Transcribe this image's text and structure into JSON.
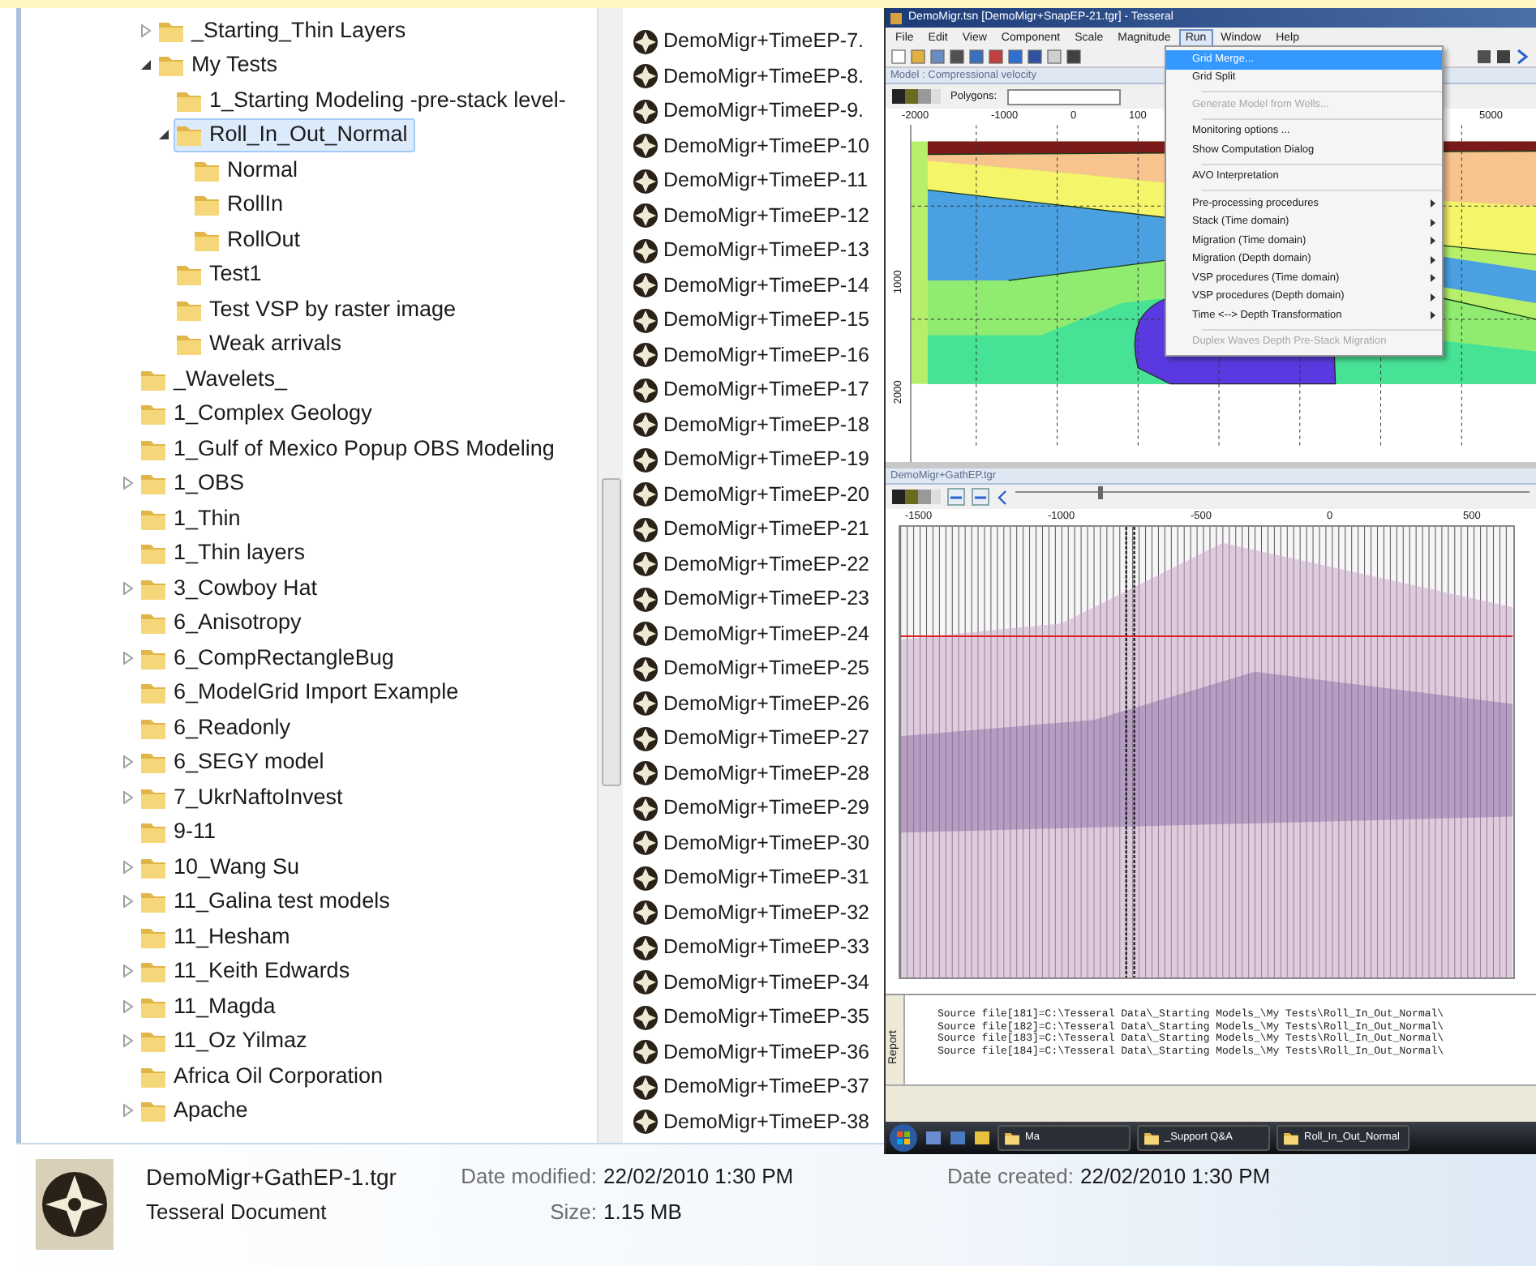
{
  "tree": {
    "nested_items": [
      {
        "label": "_Starting_Thin Layers",
        "expanded": false,
        "selected": false
      },
      {
        "label": "My Tests",
        "expanded": true,
        "selected": false,
        "children": [
          {
            "label": "1_Starting Modeling -pre-stack level-",
            "selected": false
          },
          {
            "label": "Roll_In_Out_Normal",
            "expanded": true,
            "selected": true,
            "children": [
              {
                "label": "Normal",
                "selected": false
              },
              {
                "label": "RollIn",
                "selected": false
              },
              {
                "label": "RollOut",
                "selected": false
              }
            ]
          },
          {
            "label": "Test1",
            "selected": false
          },
          {
            "label": "Test VSP by raster image",
            "selected": false
          },
          {
            "label": "Weak arrivals",
            "selected": false
          }
        ]
      }
    ],
    "items": [
      {
        "label": "_Wavelets_",
        "selected": false
      },
      {
        "label": "1_Complex Geology",
        "selected": false
      },
      {
        "label": "1_Gulf of Mexico Popup OBS Modeling",
        "selected": false
      },
      {
        "label": "1_OBS",
        "expanded": false,
        "selected": false
      },
      {
        "label": "1_Thin",
        "selected": false
      },
      {
        "label": "1_Thin layers",
        "selected": false
      },
      {
        "label": "3_Cowboy Hat",
        "expanded": false,
        "selected": false
      },
      {
        "label": "6_Anisotropy",
        "selected": false
      },
      {
        "label": "6_CompRectangleBug",
        "expanded": false,
        "selected": false
      },
      {
        "label": "6_ModelGrid Import Example",
        "selected": false
      },
      {
        "label": "6_Readonly",
        "selected": false
      },
      {
        "label": "6_SEGY model",
        "expanded": false,
        "selected": false
      },
      {
        "label": "7_UkrNaftoInvest",
        "expanded": false,
        "selected": false
      },
      {
        "label": "9-11",
        "selected": false
      },
      {
        "label": "10_Wang Su",
        "expanded": false,
        "selected": false
      },
      {
        "label": "11_Galina test models",
        "expanded": false,
        "selected": false
      },
      {
        "label": "11_Hesham",
        "selected": false
      },
      {
        "label": "11_Keith Edwards",
        "expanded": false,
        "selected": false
      },
      {
        "label": "11_Magda",
        "expanded": false,
        "selected": false
      },
      {
        "label": "11_Oz Yilmaz",
        "expanded": false,
        "selected": false
      },
      {
        "label": "Africa Oil Corporation",
        "selected": false
      },
      {
        "label": "Apache",
        "expanded": false,
        "selected": false
      }
    ]
  },
  "file_list": [
    "DemoMigr+TimeEP-7.",
    "DemoMigr+TimeEP-8.",
    "DemoMigr+TimeEP-9.",
    "DemoMigr+TimeEP-10",
    "DemoMigr+TimeEP-11",
    "DemoMigr+TimeEP-12",
    "DemoMigr+TimeEP-13",
    "DemoMigr+TimeEP-14",
    "DemoMigr+TimeEP-15",
    "DemoMigr+TimeEP-16",
    "DemoMigr+TimeEP-17",
    "DemoMigr+TimeEP-18",
    "DemoMigr+TimeEP-19",
    "DemoMigr+TimeEP-20",
    "DemoMigr+TimeEP-21",
    "DemoMigr+TimeEP-22",
    "DemoMigr+TimeEP-23",
    "DemoMigr+TimeEP-24",
    "DemoMigr+TimeEP-25",
    "DemoMigr+TimeEP-26",
    "DemoMigr+TimeEP-27",
    "DemoMigr+TimeEP-28",
    "DemoMigr+TimeEP-29",
    "DemoMigr+TimeEP-30",
    "DemoMigr+TimeEP-31",
    "DemoMigr+TimeEP-32",
    "DemoMigr+TimeEP-33",
    "DemoMigr+TimeEP-34",
    "DemoMigr+TimeEP-35",
    "DemoMigr+TimeEP-36",
    "DemoMigr+TimeEP-37",
    "DemoMigr+TimeEP-38"
  ],
  "tesseral_window": {
    "title": "DemoMigr.tsn [DemoMigr+SnapEP-21.tgr] - Tesseral",
    "menu": [
      {
        "label": "File",
        "selected": false
      },
      {
        "label": "Edit",
        "selected": false
      },
      {
        "label": "View",
        "selected": false
      },
      {
        "label": "Component",
        "selected": false
      },
      {
        "label": "Scale",
        "selected": false
      },
      {
        "label": "Magnitude",
        "selected": false
      },
      {
        "label": "Run",
        "selected": true
      },
      {
        "label": "Window",
        "selected": false
      },
      {
        "label": "Help",
        "selected": false
      }
    ],
    "run_menu": [
      {
        "kind": "item",
        "label": "Grid Merge...",
        "selected": true,
        "disabled": false
      },
      {
        "kind": "item",
        "label": "Grid Split",
        "selected": false,
        "disabled": false
      },
      {
        "kind": "separator"
      },
      {
        "kind": "item",
        "label": "Generate Model from Wells...",
        "selected": false,
        "disabled": true
      },
      {
        "kind": "separator"
      },
      {
        "kind": "item",
        "label": "Monitoring options ...",
        "selected": false,
        "disabled": false
      },
      {
        "kind": "item",
        "label": "Show Computation Dialog",
        "selected": false,
        "disabled": false
      },
      {
        "kind": "separator"
      },
      {
        "kind": "item",
        "label": "AVO Interpretation",
        "selected": false,
        "disabled": false
      },
      {
        "kind": "separator"
      },
      {
        "kind": "submenu",
        "label": "Pre-processing procedures",
        "selected": false,
        "disabled": false
      },
      {
        "kind": "submenu",
        "label": "Stack (Time domain)",
        "selected": false,
        "disabled": false
      },
      {
        "kind": "submenu",
        "label": "Migration (Time domain)",
        "selected": false,
        "disabled": false
      },
      {
        "kind": "submenu",
        "label": "Migration (Depth domain)",
        "selected": false,
        "disabled": false
      },
      {
        "kind": "submenu",
        "label": "VSP procedures  (Time domain)",
        "selected": false,
        "disabled": false
      },
      {
        "kind": "submenu",
        "label": "VSP procedures  (Depth domain)",
        "selected": false,
        "disabled": false
      },
      {
        "kind": "submenu",
        "label": "Time <--> Depth Transformation",
        "selected": false,
        "disabled": false
      },
      {
        "kind": "separator"
      },
      {
        "kind": "item",
        "label": "Duplex Waves Depth Pre-Stack Migration",
        "selected": false,
        "disabled": true
      }
    ],
    "model_pane": {
      "title": "Model : Compressional velocity",
      "polygons_label": "Polygons:",
      "x_ticks": [
        "-2000",
        "-1000",
        "0",
        "100",
        "5000"
      ],
      "y_ticks": [
        "1000",
        "2000"
      ]
    },
    "gather_pane": {
      "title": "DemoMigr+GathEP.tgr",
      "slider": {
        "level": 0.16
      },
      "x_ticks": [
        "-1500",
        "-1000",
        "-500",
        "0",
        "500"
      ]
    },
    "report": {
      "label": "Report",
      "lines": [
        "Source file[181]=C:\\Tesseral Data\\_Starting Models_\\My Tests\\Roll_In_Out_Normal\\",
        "Source file[182]=C:\\Tesseral Data\\_Starting Models_\\My Tests\\Roll_In_Out_Normal\\",
        "Source file[183]=C:\\Tesseral Data\\_Starting Models_\\My Tests\\Roll_In_Out_Normal\\",
        "Source file[184]=C:\\Tesseral Data\\_Starting Models_\\My Tests\\Roll_In_Out_Normal\\"
      ]
    }
  },
  "taskbar": {
    "buttons": [
      "Ma",
      "_Support Q&A",
      "Roll_In_Out_Normal"
    ]
  },
  "details": {
    "file_name": "DemoMigr+GathEP-1.tgr",
    "file_type": "Tesseral Document",
    "fields": [
      {
        "label": "Date modified:",
        "value": "22/02/2010 1:30 PM"
      },
      {
        "label": "Size:",
        "value": "1.15 MB"
      },
      {
        "label": "Date created:",
        "value": "22/02/2010 1:30 PM"
      }
    ]
  }
}
